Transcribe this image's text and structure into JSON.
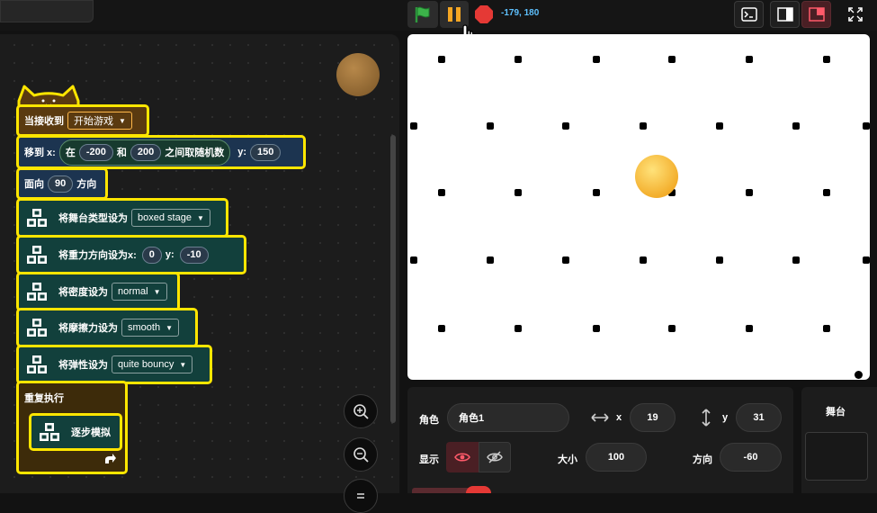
{
  "toolbar": {
    "coords": "-179, 180",
    "colors": {
      "flag": "#2e9a3e",
      "pause": "#f5a623",
      "stop": "#e53935",
      "coords": "#5ec1ff"
    }
  },
  "blocks": {
    "when_receive": "当接收到",
    "message": "开始游戏",
    "goto_label": "移到 x:",
    "random_in": "在",
    "random_from": "-200",
    "random_and": "和",
    "random_to": "200",
    "random_suffix": "之间取随机数",
    "y_label": "y:",
    "y_value": "150",
    "point_label": "面向",
    "point_value": "90",
    "point_suffix": "方向",
    "stage_type_label": "将舞台类型设为",
    "stage_type_value": "boxed stage",
    "gravity_label": "将重力方向设为x:",
    "gravity_x": "0",
    "gravity_y_label": "y:",
    "gravity_y": "-10",
    "density_label": "将密度设为",
    "density_value": "normal",
    "friction_label": "将摩擦力设为",
    "friction_value": "smooth",
    "bounce_label": "将弹性设为",
    "bounce_value": "quite bouncy",
    "forever_label": "重复执行",
    "step_label": "逐步模拟"
  },
  "sprite_panel": {
    "sprite_label": "角色",
    "sprite_name": "角色1",
    "x_label": "x",
    "x_value": "19",
    "y_label": "y",
    "y_value": "31",
    "show_label": "显示",
    "size_label": "大小",
    "size_value": "100",
    "direction_label": "方向",
    "direction_value": "-60"
  },
  "stage_panel": {
    "title": "舞台"
  }
}
